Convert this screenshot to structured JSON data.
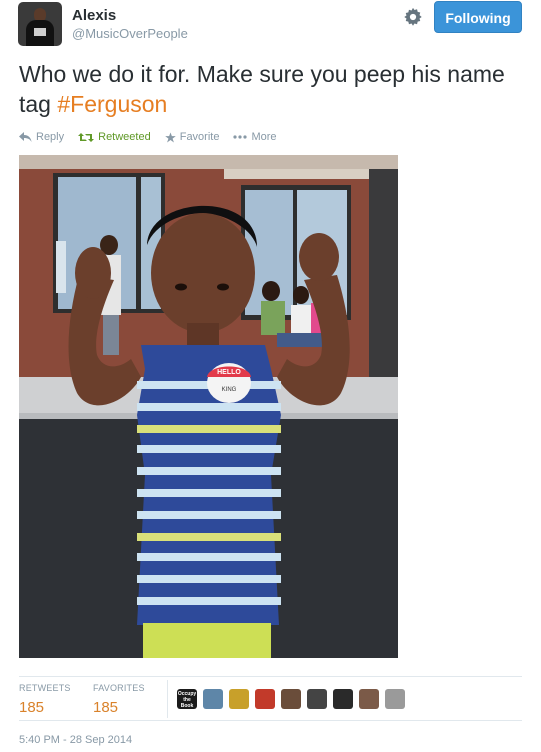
{
  "user": {
    "name": "Alexis",
    "handle": "@MusicOverPeople"
  },
  "header": {
    "follow_label": "Following",
    "settings_icon": "gear-icon"
  },
  "tweet": {
    "text": "Who we do it for. Make sure you peep his name tag ",
    "hashtag": "#Ferguson",
    "hashtag_color": "#e67e22"
  },
  "actions": {
    "reply": "Reply",
    "retweeted": "Retweeted",
    "favorite": "Favorite",
    "more": "More"
  },
  "photo": {
    "name_tag_hello": "HELLO",
    "name_tag_name": "KING"
  },
  "stats": {
    "retweets_label": "RETWEETS",
    "retweets_value": "185",
    "favorites_label": "FAVORITES",
    "favorites_value": "185",
    "faces": [
      {
        "color": "#1b1b1b",
        "text": "Occupy the Book"
      },
      {
        "color": "#5e86a8"
      },
      {
        "color": "#c8a02a"
      },
      {
        "color": "#c23a2a"
      },
      {
        "color": "#6a4d3a"
      },
      {
        "color": "#444444"
      },
      {
        "color": "#2a2a2a"
      },
      {
        "color": "#7b5a48"
      },
      {
        "color": "#9a9a9a"
      }
    ]
  },
  "timestamp": "5:40 PM - 28 Sep 2014",
  "colors": {
    "accent": "#3b94d9",
    "count": "#d9822b",
    "retweet_green": "#609928"
  }
}
